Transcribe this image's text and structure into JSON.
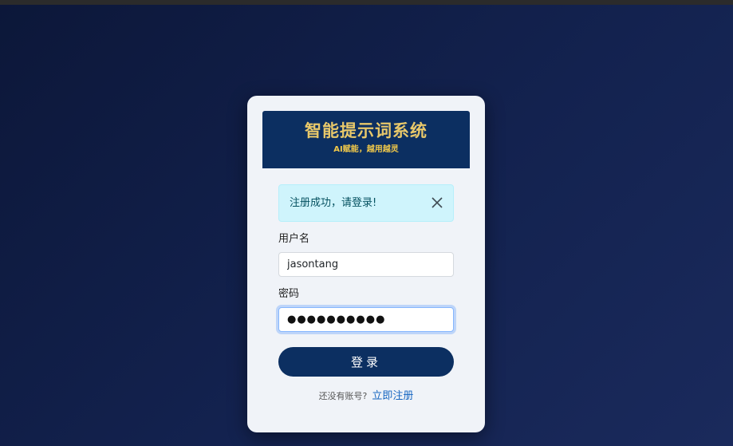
{
  "header": {
    "title": "智能提示词系统",
    "subtitle": "AI赋能，越用越灵"
  },
  "alert": {
    "message": "注册成功，请登录!",
    "close_icon": "close-icon"
  },
  "form": {
    "username_label": "用户名",
    "username_value": "jasontang",
    "password_label": "密码",
    "password_masked": "●●●●●●●●●●",
    "submit_label": "登录"
  },
  "footer": {
    "prompt": "还没有账号?",
    "register_link": "立即注册"
  },
  "colors": {
    "background": "#13224f",
    "card": "#f0f3f8",
    "banner": "#0c2f61",
    "banner_title": "#e8c86a",
    "alert_bg": "#cff4fc",
    "button": "#0c2f61",
    "link": "#1565c0"
  }
}
